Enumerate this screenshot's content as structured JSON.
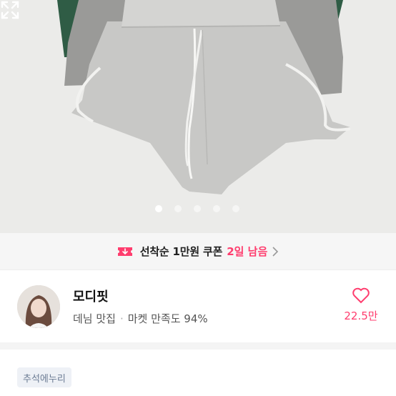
{
  "product_image": {
    "image_count": 5,
    "active_index": 1,
    "expand_icon": "expand-icon"
  },
  "coupon": {
    "icon": "coupon-download-icon",
    "text": "선착순 1만원 쿠폰",
    "highlight": "2일 남음",
    "highlight_color": "#ff3d6e",
    "arrow_icon": "chevron-right-icon"
  },
  "shop": {
    "name": "모디핏",
    "category": "데님 맛집",
    "separator": "·",
    "satisfaction": "마켓 만족도 94%",
    "like_icon": "heart-icon",
    "like_count": "22.5만"
  },
  "tag": {
    "label": "추석에누리"
  }
}
